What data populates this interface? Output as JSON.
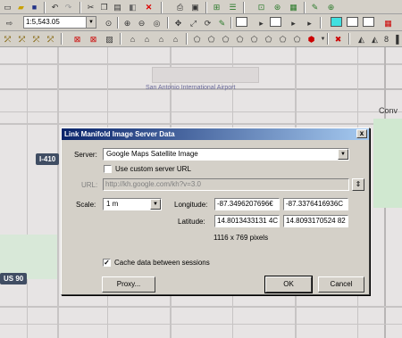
{
  "toolbar": {
    "scale_value": "1:5,543.05",
    "page_number": "8"
  },
  "map": {
    "airport_label": "San Antonio International Airport",
    "place_label_right": "Conv",
    "highway_410": "I-410",
    "highway_90": "US 90"
  },
  "dialog": {
    "title": "Link Manifold Image Server Data",
    "close_label": "x",
    "server_label": "Server:",
    "server_value": "Google Maps Satellite Image",
    "use_custom_label": "Use custom server URL",
    "use_custom_checked": false,
    "url_label": "URL:",
    "url_value": "http://kh.google.com/kh?v=3.0",
    "scale_label": "Scale:",
    "scale_value": "1 m",
    "longitude_label": "Longitude:",
    "longitude_1": "-87.3496207696€",
    "longitude_2": "-87.3376416936C",
    "latitude_label": "Latitude:",
    "latitude_1": "14.8013433131 4C",
    "latitude_2": "14.8093170524 82",
    "pixels_text": "1116 x 769 pixels",
    "cache_label": "Cache data between sessions",
    "cache_checked": true,
    "proxy_button": "Proxy...",
    "ok_button": "OK",
    "cancel_button": "Cancel"
  }
}
